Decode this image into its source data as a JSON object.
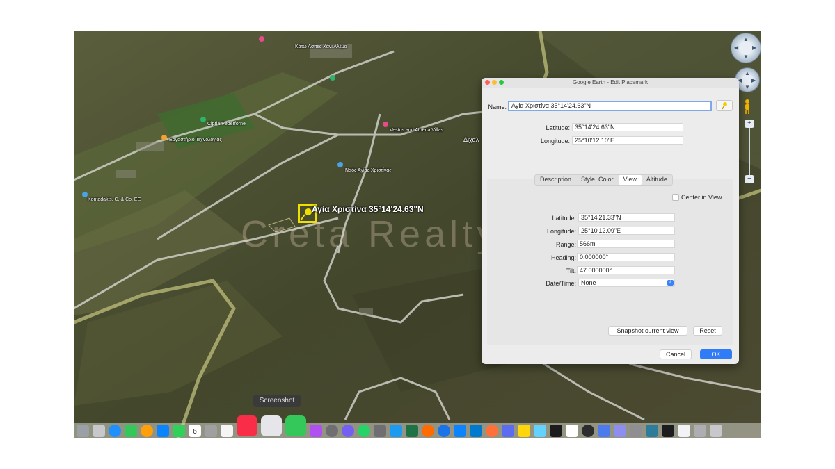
{
  "map": {
    "placemark_label": "Αγία Χριστίνα 35°14'24.63\"N",
    "watermark": "Creta Realty",
    "labels": [
      "Κάτω Ασίτες Χάνι Αλέμα",
      "Cipria Pederforne",
      "Εργαστήριο Τεχνολογίας",
      "Vestos and Athena Villas",
      "Ναός Αγίας Χριστίνας",
      "Kontadakis, C. & Co. EE",
      "Διχαλ"
    ],
    "tooltip": "Screenshot",
    "dock_calendar_day": "6"
  },
  "dialog": {
    "title": "Google Earth - Edit Placemark",
    "name_label": "Name:",
    "name_value": "Αγία Χριστίνα 35°14'24.63\"N",
    "top_latitude_label": "Latitude:",
    "top_latitude_value": "35°14'24.63\"N",
    "top_longitude_label": "Longitude:",
    "top_longitude_value": "25°10'12.10\"E",
    "tabs": [
      "Description",
      "Style, Color",
      "View",
      "Altitude"
    ],
    "selected_tab": "View",
    "center_in_view_label": "Center in View",
    "view": {
      "latitude_label": "Latitude:",
      "latitude_value": "35°14'21.33\"N",
      "longitude_label": "Longitude:",
      "longitude_value": "25°10'12.09\"E",
      "range_label": "Range:",
      "range_value": "566m",
      "heading_label": "Heading:",
      "heading_value": "0.000000°",
      "tilt_label": "Tilt:",
      "tilt_value": "47.000000°",
      "datetime_label": "Date/Time:",
      "datetime_value": "None"
    },
    "snapshot_label": "Snapshot current view",
    "reset_label": "Reset",
    "cancel_label": "Cancel",
    "ok_label": "OK"
  },
  "colors": {
    "accent": "#2f7cf6",
    "placemark": "#f0e000",
    "close": "#fe5f57",
    "minimize": "#febc2e",
    "zoom": "#28c840"
  }
}
